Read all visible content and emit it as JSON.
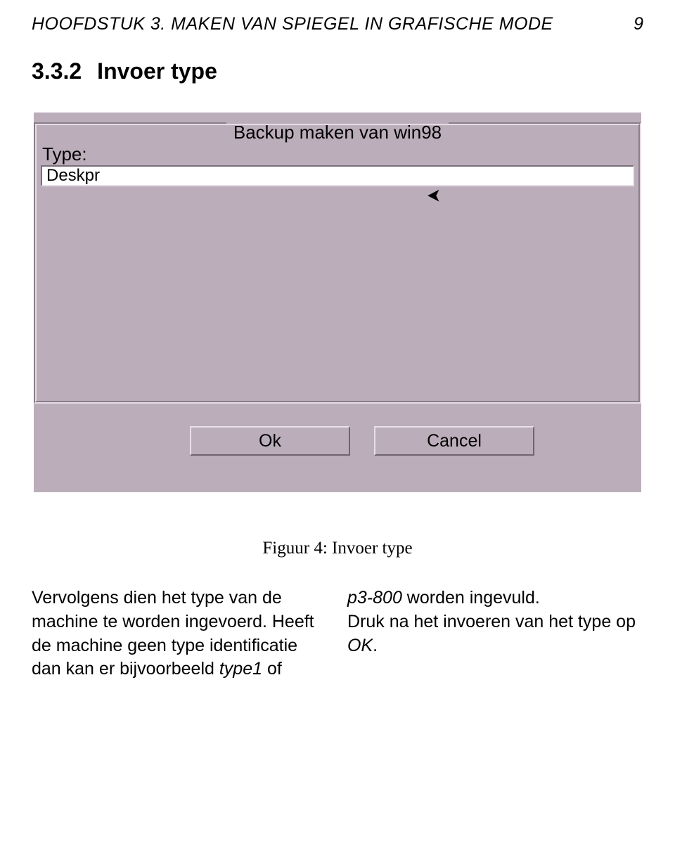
{
  "header": {
    "left": "HOOFDSTUK 3. MAKEN VAN SPIEGEL IN GRAFISCHE MODE",
    "page_number": "9"
  },
  "section": {
    "number": "3.3.2",
    "title": "Invoer type"
  },
  "dialog": {
    "group_title": "Backup maken van win98",
    "type_label": "Type:",
    "type_value": "Deskpr",
    "ok_label": "Ok",
    "cancel_label": "Cancel"
  },
  "figure_caption": "Figuur 4: Invoer type",
  "body": {
    "left_col": {
      "line1": "Vervolgens dien het type van de",
      "line2": "machine te worden ingevoerd. Heeft",
      "line3": "de machine geen type identificatie",
      "line4_a": "dan kan er bijvoorbeeld ",
      "line4_b": "type1",
      "line4_c": " of"
    },
    "right_col": {
      "line1_a": "p3-800",
      "line1_b": " worden ingevuld.",
      "line2": "Druk na het invoeren van het type op",
      "line3_a": "OK",
      "line3_b": "."
    }
  }
}
